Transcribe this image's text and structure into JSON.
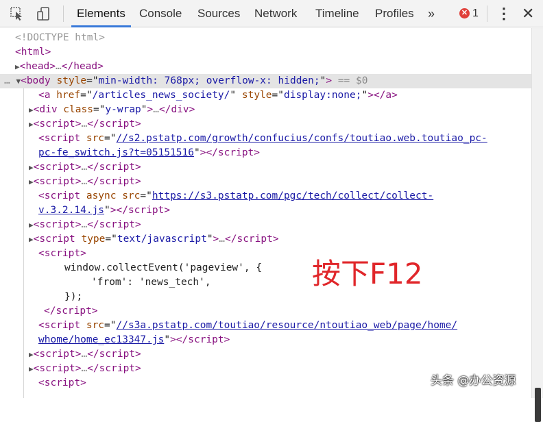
{
  "toolbar": {
    "inspect_icon": "cursor-select-icon",
    "device_icon": "device-toggle-icon",
    "tabs": [
      {
        "label": "Elements",
        "active": true
      },
      {
        "label": "Console"
      },
      {
        "label": "Sources"
      },
      {
        "label": "Network"
      },
      {
        "label": "Timeline"
      },
      {
        "label": "Profiles"
      }
    ],
    "more": "»",
    "error_badge": "✕",
    "error_count": "1",
    "menu": "⋮",
    "close": "✕"
  },
  "dom": {
    "doctype": "<!DOCTYPE html>",
    "html_open": "<html>",
    "head": "head",
    "body_style": "min-width: 768px; overflow-x: hidden;",
    "selected_marker": " == $0",
    "a_href": "/articles_news_society/",
    "a_style": "display:none;",
    "div_class": "y-wrap",
    "script1_src_a": "//s2.pstatp.com/growth/confucius/confs/toutiao.web.toutiao_pc-",
    "script1_src_b": "pc-fe_switch.js?t=05151516",
    "script2_src_a": "https://s3.pstatp.com/pgc/tech/collect/collect-",
    "script2_src_b": "v.3.2.14.js",
    "script_type": "text/javascript",
    "js_1": "window.collectEvent('pageview', {",
    "js_2": "'from': 'news_tech',",
    "js_3": "});",
    "script3_src_a": "//s3a.pstatp.com/toutiao/resource/ntoutiao_web/page/home/",
    "script3_src_b": "whome/home_ec13347.js"
  },
  "overlay_text": "按下F12",
  "watermark": "头条 @办公资源",
  "colors": {
    "tag": "#881280",
    "attribute": "#994500",
    "value": "#1a1aa6",
    "active_tab_underline": "#3879d9",
    "error": "#e0403a",
    "overlay": "#e0262a"
  }
}
